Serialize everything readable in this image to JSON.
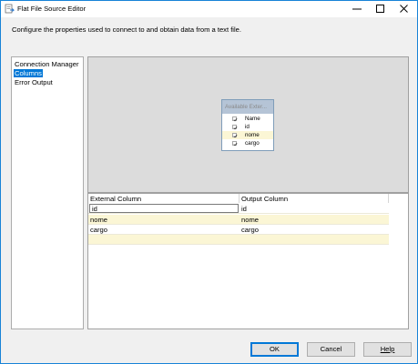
{
  "window": {
    "title": "Flat File Source Editor",
    "icon": "flat-file-source-icon"
  },
  "instruction": "Configure the properties used to connect to and obtain data from a text file.",
  "nav": {
    "items": [
      {
        "label": "Connection Manager",
        "selected": false
      },
      {
        "label": "Columns",
        "selected": true
      },
      {
        "label": "Error Output",
        "selected": false
      }
    ]
  },
  "available_columns": {
    "title": "Available Exter...",
    "header_label": "Name",
    "items": [
      {
        "label": "id",
        "checked": true,
        "highlighted": false
      },
      {
        "label": "nome",
        "checked": true,
        "highlighted": true
      },
      {
        "label": "cargo",
        "checked": true,
        "highlighted": false
      }
    ]
  },
  "mapping_grid": {
    "headers": [
      "External Column",
      "Output Column"
    ],
    "rows": [
      {
        "external": "id",
        "output": "id"
      },
      {
        "external": "nome",
        "output": "nome"
      },
      {
        "external": "cargo",
        "output": "cargo"
      },
      {
        "external": "",
        "output": ""
      }
    ]
  },
  "buttons": {
    "ok": "OK",
    "cancel": "Cancel",
    "help": "Help"
  },
  "colors": {
    "accent": "#0078d7",
    "row_highlight": "#fbf6d5",
    "preview_background": "#dcdcdc"
  }
}
